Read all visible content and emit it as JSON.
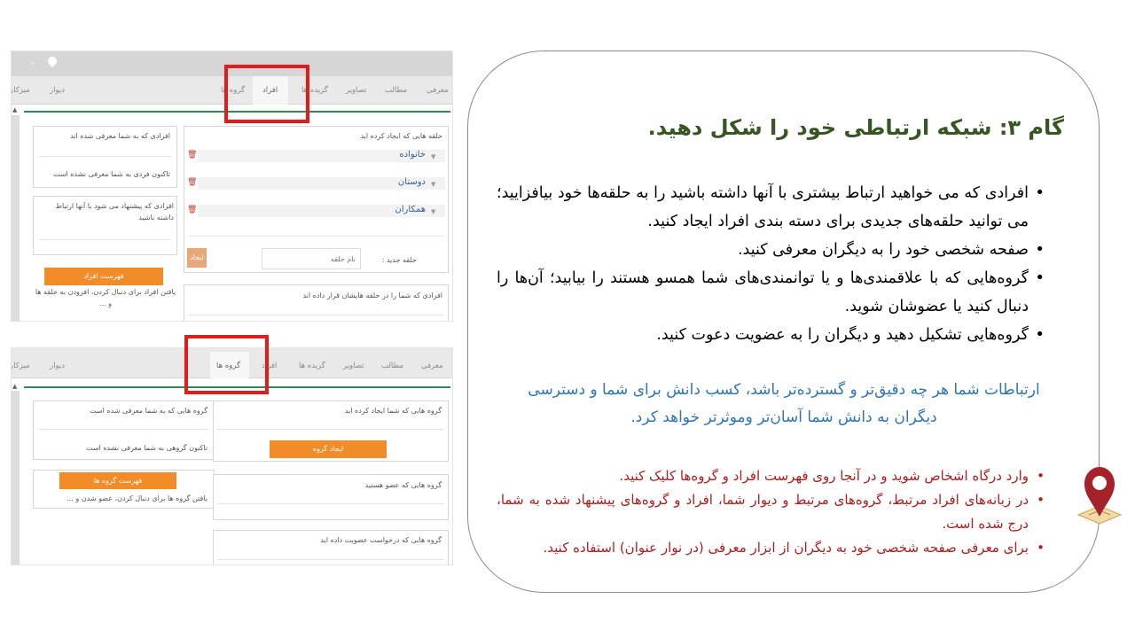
{
  "screenshot_top": {
    "tabs": [
      "معرفی",
      "مطالب",
      "تصاویر",
      "گزیده ها",
      "افراد",
      "گروه ها",
      "دیوار",
      "میزکار"
    ],
    "active_tab": "افراد",
    "left_panel": {
      "introduced": "افرادی که به شما معرفی شده اند",
      "introduced_empty": "تاکنون فردی به شما معرفی نشده است",
      "suggested": "افرادی که پیشنهاد می شود با آنها ارتباط داشته باشید",
      "list_button": "فهرست افراد",
      "list_hint": "یافتن افراد برای دنبال کردن، افزودن به حلقه ها و ..."
    },
    "right_panel": {
      "circles_title": "حلقه هایی که ایجاد کرده اید",
      "circles": [
        "خانواده",
        "دوستان",
        "همکاران"
      ],
      "new_circle_label": "حلقه جدید :",
      "new_circle_placeholder": "نام حلقه",
      "create_button": "ایجاد",
      "added_you": "افرادی که شما را در حلقه هایشان قرار داده اند"
    }
  },
  "screenshot_bottom": {
    "tabs": [
      "معرفی",
      "مطالب",
      "تصاویر",
      "گزیده ها",
      "افراد",
      "گروه ها",
      "دیوار",
      "میزکار"
    ],
    "active_tab": "گروه ها",
    "left_panel": {
      "introduced": "گروه هایی که به شما معرفی شده است",
      "introduced_empty": "تاکنون گروهی به شما معرفی نشده است",
      "list_button": "فهرست گروه ها",
      "list_hint": "یافتن گروه ها برای دنبال کردن، عضو شدن و ..."
    },
    "right_panel": {
      "created": "گروه هایی که شما ایجاد کرده اید",
      "create_button": "ایجاد گروه",
      "member": "گروه هایی که عضو هستید",
      "requested": "گروه هایی که درخواست عضویت داده اید"
    }
  },
  "slide": {
    "heading": "گام ۳: شبکه ارتباطی خود را شکل دهید.",
    "bullets": [
      "افرادی که می خواهید ارتباط بیشتری با آنها داشته باشید را به حلقه‌ها خود بیافزایید؛ می توانید حلقه‌های جدیدی برای دسته بندی افراد ایجاد کنید.",
      "صفحه شخصی خود را به دیگران معرفی کنید.",
      "گروه‌هایی که با علاقمندی‌ها و یا توانمندی‌های شما همسو هستند را بیابید؛ آن‌ها را دنبال کنید یا عضوشان شوید.",
      "گروه‌هایی تشکیل دهید و دیگران را به عضویت دعوت کنید."
    ],
    "paragraph": "ارتباطات شما هر چه دقیق‌تر و گسترده‌تر باشد، کسب دانش برای شما و دسترسی دیگران به دانش شما آسان‌تر وموثرتر خواهد کرد.",
    "tips": [
      "وارد درگاه اشخاص شوید و در آنجا روی فهرست افراد و گروه‌ها کلیک کنید.",
      "در زبانه‌های افراد مرتبط، گروه‌های مرتبط و دیوار شما، افراد و گروه‌های پیشنهاد شده به شما، درج شده است.",
      "برای معرفی صفحه شخصی خود به دیگران از ابزار معرفی (در نوار عنوان) استفاده کنید."
    ]
  },
  "colors": {
    "heading": "#375623",
    "paragraph": "#2e75b6",
    "tips": "#b01c1c",
    "highlight": "#e51b1b",
    "button": "#f28c28"
  }
}
